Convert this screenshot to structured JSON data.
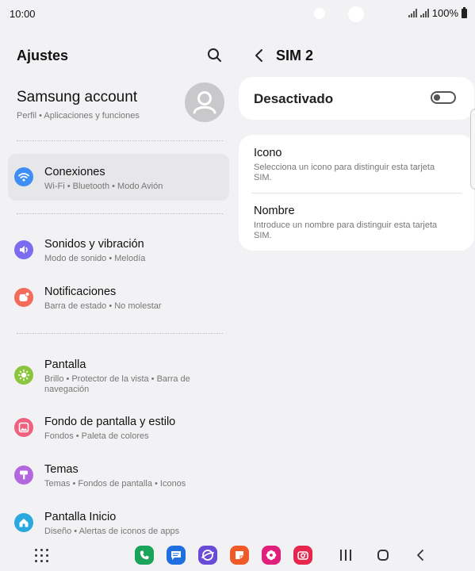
{
  "status": {
    "time": "10:00",
    "battery": "100%"
  },
  "left": {
    "title": "Ajustes",
    "account": {
      "name": "Samsung account",
      "subtitle": "Perfil  •  Aplicaciones y funciones"
    },
    "items": [
      {
        "title": "Conexiones",
        "subtitle": "Wi-Fi  •  Bluetooth  •  Modo Avión",
        "icon": "wifi-icon",
        "color": "#3e8ef5"
      },
      {
        "title": "Sonidos y vibración",
        "subtitle": "Modo de sonido  •  Melodía",
        "icon": "volume-icon",
        "color": "#7b6cf0"
      },
      {
        "title": "Notificaciones",
        "subtitle": "Barra de estado  •  No molestar",
        "icon": "notification-icon",
        "color": "#f36b5a"
      },
      {
        "title": "Pantalla",
        "subtitle": "Brillo  •  Protector de la vista  •  Barra de navegación",
        "icon": "brightness-icon",
        "color": "#8bc53f"
      },
      {
        "title": "Fondo de pantalla y estilo",
        "subtitle": "Fondos  •  Paleta de colores",
        "icon": "wallpaper-icon",
        "color": "#f0607f"
      },
      {
        "title": "Temas",
        "subtitle": "Temas  •  Fondos de pantalla  •  Iconos",
        "icon": "themes-icon",
        "color": "#b368e0"
      },
      {
        "title": "Pantalla Inicio",
        "subtitle": "Diseño  •  Alertas de iconos de apps",
        "icon": "home-screen-icon",
        "color": "#2aa8e0"
      }
    ]
  },
  "right": {
    "title": "SIM 2",
    "toggle": {
      "label": "Desactivado",
      "on": false
    },
    "options": [
      {
        "title": "Icono",
        "subtitle": "Selecciona un icono para distinguir esta tarjeta SIM."
      },
      {
        "title": "Nombre",
        "subtitle": "Introduce un nombre para distinguir esta tarjeta SIM."
      }
    ]
  },
  "dock": [
    {
      "name": "phone-app-icon",
      "color": "#1aa35a"
    },
    {
      "name": "messages-app-icon",
      "color": "#1f6fe0"
    },
    {
      "name": "internet-app-icon",
      "color": "#6a4bd8"
    },
    {
      "name": "notes-app-icon",
      "color": "#f05a28"
    },
    {
      "name": "gallery-app-icon",
      "color": "#e0207a"
    },
    {
      "name": "camera-app-icon",
      "color": "#e8264d"
    }
  ]
}
